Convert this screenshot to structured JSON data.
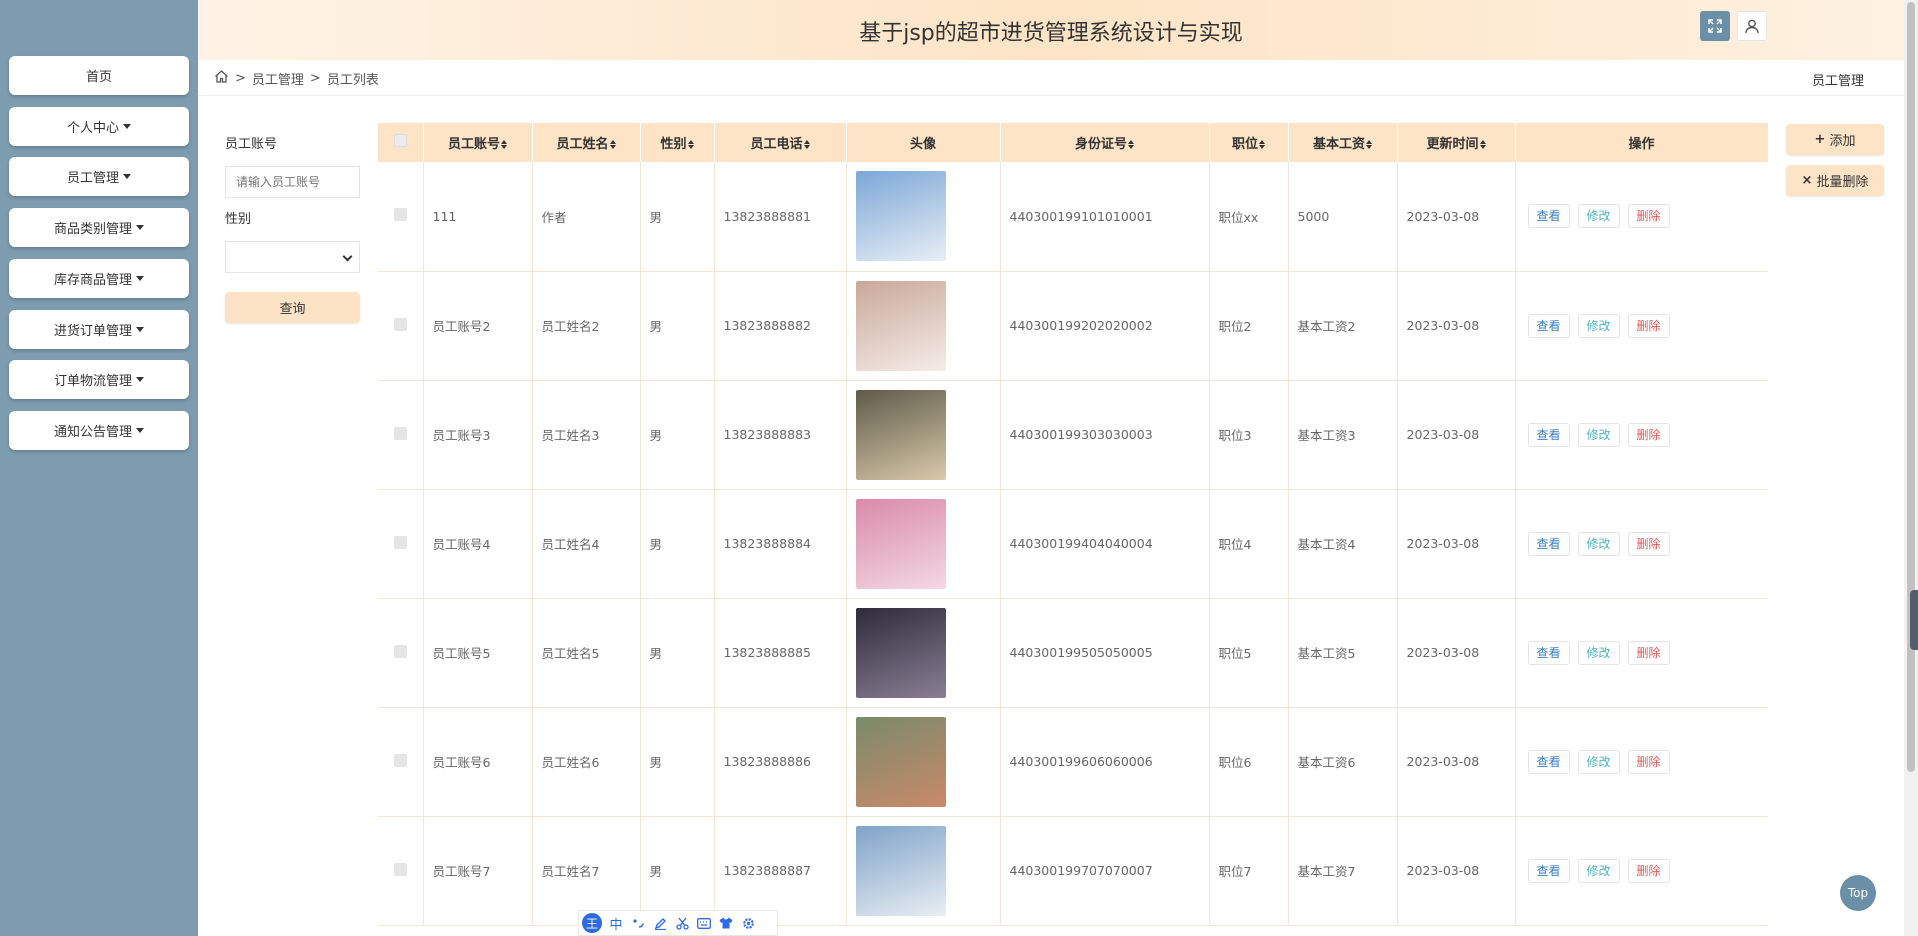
{
  "header": {
    "title": "基于jsp的超市进货管理系统设计与实现"
  },
  "sidebar": {
    "items": [
      {
        "label": "首页",
        "dropdown": false
      },
      {
        "label": "个人中心",
        "dropdown": true
      },
      {
        "label": "员工管理",
        "dropdown": true
      },
      {
        "label": "商品类别管理",
        "dropdown": true
      },
      {
        "label": "库存商品管理",
        "dropdown": true
      },
      {
        "label": "进货订单管理",
        "dropdown": true
      },
      {
        "label": "订单物流管理",
        "dropdown": true
      },
      {
        "label": "通知公告管理",
        "dropdown": true
      }
    ]
  },
  "breadcrumb": {
    "sep": ">",
    "level1": "员工管理",
    "level2": "员工列表",
    "right": "员工管理"
  },
  "filter": {
    "account_label": "员工账号",
    "account_placeholder": "请输入员工账号",
    "gender_label": "性别",
    "gender_value": "",
    "query_label": "查询"
  },
  "actions": {
    "add_label": "添加",
    "batch_delete_label": "批量删除"
  },
  "table": {
    "columns": [
      "员工账号",
      "员工姓名",
      "性别",
      "员工电话",
      "头像",
      "身份证号",
      "职位",
      "基本工资",
      "更新时间",
      "操作"
    ],
    "ops": {
      "view": "查看",
      "edit": "修改",
      "delete": "删除"
    },
    "rows": [
      {
        "account": "111",
        "name": "作者",
        "gender": "男",
        "phone": "13823888881",
        "idcard": "440300199101010001",
        "position": "职位xx",
        "salary": "5000",
        "updated": "2023-03-08"
      },
      {
        "account": "员工账号2",
        "name": "员工姓名2",
        "gender": "男",
        "phone": "13823888882",
        "idcard": "440300199202020002",
        "position": "职位2",
        "salary": "基本工资2",
        "updated": "2023-03-08"
      },
      {
        "account": "员工账号3",
        "name": "员工姓名3",
        "gender": "男",
        "phone": "13823888883",
        "idcard": "440300199303030003",
        "position": "职位3",
        "salary": "基本工资3",
        "updated": "2023-03-08"
      },
      {
        "account": "员工账号4",
        "name": "员工姓名4",
        "gender": "男",
        "phone": "13823888884",
        "idcard": "440300199404040004",
        "position": "职位4",
        "salary": "基本工资4",
        "updated": "2023-03-08"
      },
      {
        "account": "员工账号5",
        "name": "员工姓名5",
        "gender": "男",
        "phone": "13823888885",
        "idcard": "440300199505050005",
        "position": "职位5",
        "salary": "基本工资5",
        "updated": "2023-03-08"
      },
      {
        "account": "员工账号6",
        "name": "员工姓名6",
        "gender": "男",
        "phone": "13823888886",
        "idcard": "440300199606060006",
        "position": "职位6",
        "salary": "基本工资6",
        "updated": "2023-03-08"
      },
      {
        "account": "员工账号7",
        "name": "员工姓名7",
        "gender": "男",
        "phone": "13823888887",
        "idcard": "440300199707070007",
        "position": "职位7",
        "salary": "基本工资7",
        "updated": "2023-03-08"
      }
    ]
  },
  "top_button": "Top",
  "ime": {
    "mode": "中"
  },
  "colors": {
    "sidebar": "#7d9cb0",
    "header_accent": "#fde4c6",
    "view": "#3b7fc4",
    "edit": "#4fb4c0",
    "delete": "#e05a5a"
  }
}
